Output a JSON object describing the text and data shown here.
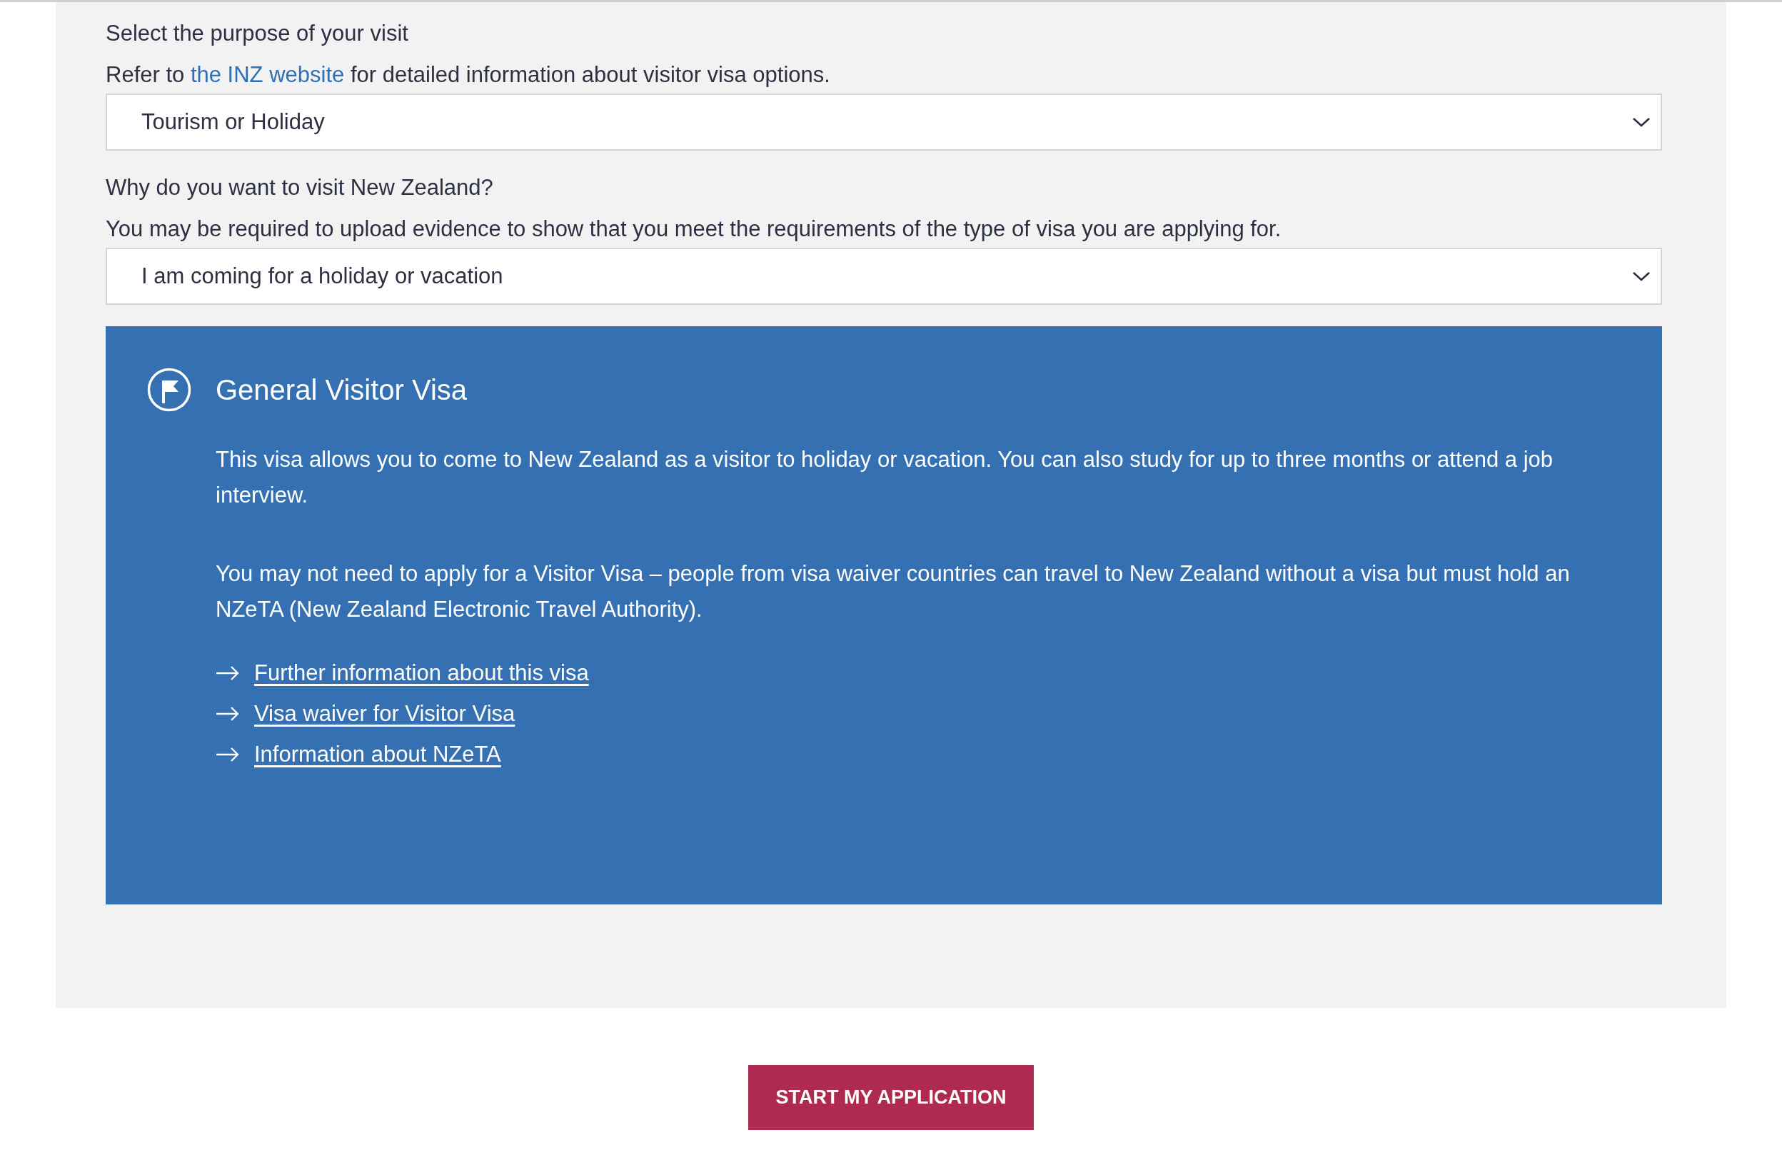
{
  "fields": [
    {
      "label": "Select the purpose of your visit",
      "hint": [
        {
          "kind": "text",
          "text": "Refer to "
        },
        {
          "kind": "link",
          "text": "the INZ website"
        },
        {
          "kind": "text",
          "text": " for detailed information about visitor visa options."
        }
      ],
      "value": "Tourism or Holiday"
    },
    {
      "label": "Why do you want to visit New Zealand?",
      "hint": [
        {
          "kind": "text",
          "text": "You may be required to upload evidence to show that you meet the requirements of the type of visa you are applying for."
        }
      ],
      "value": "I am coming for a holiday or vacation"
    }
  ],
  "info_card": {
    "title": "General Visitor Visa",
    "paragraphs": [
      "This visa allows you to come to New Zealand as a visitor to holiday or vacation. You can also study for up to three months or attend a job interview.",
      "You may not need to apply for a Visitor Visa – people from visa waiver countries can travel to New Zealand without a visa but must hold an NZeTA (New Zealand Electronic Travel Authority)."
    ],
    "links": [
      "Further information about this visa",
      "Visa waiver for Visitor Visa",
      "Information about NZeTA"
    ]
  },
  "button": "START MY APPLICATION"
}
